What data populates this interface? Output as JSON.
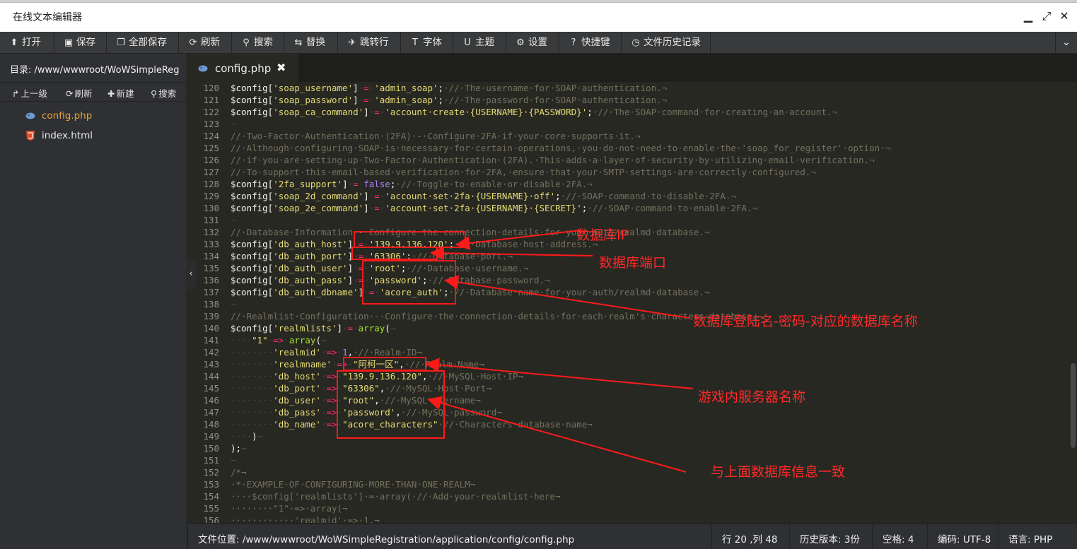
{
  "window": {
    "title": "在线文本编辑器",
    "minimize_glyph": "▁",
    "maximize_glyph": "⤢",
    "close_glyph": "✕"
  },
  "toolbar": [
    {
      "label": "打开",
      "icon": "upload-icon",
      "glyph": "⬆"
    },
    {
      "label": "保存",
      "icon": "save-icon",
      "glyph": "▣"
    },
    {
      "label": "全部保存",
      "icon": "save-all-icon",
      "glyph": "❐"
    },
    {
      "label": "刷新",
      "icon": "refresh-icon",
      "glyph": "⟳"
    },
    {
      "label": "搜索",
      "icon": "search-icon",
      "glyph": "⚲"
    },
    {
      "label": "替换",
      "icon": "replace-icon",
      "glyph": "⇆"
    },
    {
      "label": "跳转行",
      "icon": "goto-line-icon",
      "glyph": "✈"
    },
    {
      "label": "字体",
      "icon": "font-icon",
      "glyph": "T"
    },
    {
      "label": "主题",
      "icon": "theme-icon",
      "glyph": "U"
    },
    {
      "label": "设置",
      "icon": "gear-icon",
      "glyph": "⚙"
    },
    {
      "label": "快捷键",
      "icon": "help-icon",
      "glyph": "?"
    },
    {
      "label": "文件历史记录",
      "icon": "history-icon",
      "glyph": "◷"
    }
  ],
  "toolbar_dropdown_glyph": "⌄",
  "sidebar": {
    "dir_label": "目录:",
    "dir_path": "/www/wwwroot/WoWSimpleRegi",
    "tools": [
      {
        "label": "上一级",
        "icon": "up-level-icon",
        "glyph": "↱"
      },
      {
        "label": "刷新",
        "icon": "refresh-icon",
        "glyph": "⟳"
      },
      {
        "label": "新建",
        "icon": "plus-icon",
        "glyph": "✚"
      },
      {
        "label": "搜索",
        "icon": "search-icon",
        "glyph": "⚲"
      }
    ],
    "files": [
      {
        "name": "config.php",
        "type": "php",
        "color": "#e6a23c"
      },
      {
        "name": "index.html",
        "type": "html",
        "color": "#e8e8e8"
      }
    ],
    "collapse_glyph": "‹"
  },
  "tab": {
    "name": "config.php",
    "close_glyph": "✖"
  },
  "code_lines": [
    {
      "n": "120",
      "t": [
        [
          "$config[",
          "v"
        ],
        [
          "'soap_username'",
          "s"
        ],
        [
          "]",
          "v"
        ],
        [
          "·",
          "ws"
        ],
        [
          "=",
          "o"
        ],
        [
          "·",
          "ws"
        ],
        [
          "'admin_soap'",
          "s"
        ],
        [
          ";",
          "v"
        ],
        [
          "·//·The·username·for·SOAP·authentication.¬",
          "c"
        ]
      ]
    },
    {
      "n": "121",
      "t": [
        [
          "$config[",
          "v"
        ],
        [
          "'soap_password'",
          "s"
        ],
        [
          "]",
          "v"
        ],
        [
          "·",
          "ws"
        ],
        [
          "=",
          "o"
        ],
        [
          "·",
          "ws"
        ],
        [
          "'admin_soap'",
          "s"
        ],
        [
          ";",
          "v"
        ],
        [
          "·//·The·password·for·SOAP·authentication.¬",
          "c"
        ]
      ]
    },
    {
      "n": "122",
      "t": [
        [
          "$config[",
          "v"
        ],
        [
          "'soap_ca_command'",
          "s"
        ],
        [
          "]",
          "v"
        ],
        [
          "·",
          "ws"
        ],
        [
          "=",
          "o"
        ],
        [
          "·",
          "ws"
        ],
        [
          "'account·create·{USERNAME}·{PASSWORD}'",
          "s"
        ],
        [
          ";",
          "v"
        ],
        [
          "·//·The·SOAP·command·for·creating·an·account.¬",
          "c"
        ]
      ]
    },
    {
      "n": "123",
      "t": [
        [
          "¬",
          "ws"
        ]
      ]
    },
    {
      "n": "124",
      "t": [
        [
          "//·Two-Factor·Authentication·(2FA)·-·Configure·2FA·if·your·core·supports·it.¬",
          "c"
        ]
      ]
    },
    {
      "n": "125",
      "t": [
        [
          "//·Although·configuring·SOAP·is·necessary·for·certain·operations,·you·do·not·need·to·enable·the·'soap_for_register'·option·¬",
          "c"
        ]
      ]
    },
    {
      "n": "126",
      "t": [
        [
          "//·if·you·are·setting·up·Two-Factor·Authentication·(2FA).·This·adds·a·layer·of·security·by·utilizing·email·verification.¬",
          "c"
        ]
      ]
    },
    {
      "n": "127",
      "t": [
        [
          "//·To·support·this·email-based·verification·for·2FA,·ensure·that·your·SMTP·settings·are·correctly·configured.¬",
          "c"
        ]
      ]
    },
    {
      "n": "128",
      "t": [
        [
          "$config[",
          "v"
        ],
        [
          "'2fa_support'",
          "s"
        ],
        [
          "]",
          "v"
        ],
        [
          "·",
          "ws"
        ],
        [
          "=",
          "o"
        ],
        [
          "·",
          "ws"
        ],
        [
          "false",
          "k"
        ],
        [
          ";",
          "v"
        ],
        [
          "·//·Toggle·to·enable·or·disable·2FA.¬",
          "c"
        ]
      ]
    },
    {
      "n": "129",
      "t": [
        [
          "$config[",
          "v"
        ],
        [
          "'soap_2d_command'",
          "s"
        ],
        [
          "]",
          "v"
        ],
        [
          "·",
          "ws"
        ],
        [
          "=",
          "o"
        ],
        [
          "·",
          "ws"
        ],
        [
          "'account·set·2fa·{USERNAME}·off'",
          "s"
        ],
        [
          ";",
          "v"
        ],
        [
          "·//·SOAP·command·to·disable·2FA.¬",
          "c"
        ]
      ]
    },
    {
      "n": "130",
      "t": [
        [
          "$config[",
          "v"
        ],
        [
          "'soap_2e_command'",
          "s"
        ],
        [
          "]",
          "v"
        ],
        [
          "·",
          "ws"
        ],
        [
          "=",
          "o"
        ],
        [
          "·",
          "ws"
        ],
        [
          "'account·set·2fa·{USERNAME}·{SECRET}'",
          "s"
        ],
        [
          ";",
          "v"
        ],
        [
          "·//·SOAP·command·to·enable·2FA.¬",
          "c"
        ]
      ]
    },
    {
      "n": "131",
      "t": [
        [
          "¬",
          "ws"
        ]
      ]
    },
    {
      "n": "132",
      "t": [
        [
          "//·Database·Information·-·Configure·the·connection·details·for·your·auth/realmd·database.¬",
          "c"
        ]
      ]
    },
    {
      "n": "133",
      "t": [
        [
          "$config[",
          "v"
        ],
        [
          "'db_auth_host'",
          "s"
        ],
        [
          "]",
          "v"
        ],
        [
          "·",
          "ws"
        ],
        [
          "=",
          "o"
        ],
        [
          "·",
          "ws"
        ],
        [
          "'139.9.136.120'",
          "s"
        ],
        [
          ";",
          "v"
        ],
        [
          "·//·Database·host·address.¬",
          "c"
        ]
      ]
    },
    {
      "n": "134",
      "t": [
        [
          "$config[",
          "v"
        ],
        [
          "'db_auth_port'",
          "s"
        ],
        [
          "]",
          "v"
        ],
        [
          "·",
          "ws"
        ],
        [
          "=",
          "o"
        ],
        [
          "·",
          "ws"
        ],
        [
          "'63306'",
          "s"
        ],
        [
          ";",
          "v"
        ],
        [
          "·//·Database·port.¬",
          "c"
        ]
      ]
    },
    {
      "n": "135",
      "t": [
        [
          "$config[",
          "v"
        ],
        [
          "'db_auth_user'",
          "s"
        ],
        [
          "]",
          "v"
        ],
        [
          "·",
          "ws"
        ],
        [
          "=",
          "o"
        ],
        [
          "·",
          "ws"
        ],
        [
          "'root'",
          "s"
        ],
        [
          ";",
          "v"
        ],
        [
          "·//·Database·username.¬",
          "c"
        ]
      ]
    },
    {
      "n": "136",
      "t": [
        [
          "$config[",
          "v"
        ],
        [
          "'db_auth_pass'",
          "s"
        ],
        [
          "]",
          "v"
        ],
        [
          "·",
          "ws"
        ],
        [
          "=",
          "o"
        ],
        [
          "·",
          "ws"
        ],
        [
          "'password'",
          "s"
        ],
        [
          ";",
          "v"
        ],
        [
          "·//·Database·password.¬",
          "c"
        ]
      ]
    },
    {
      "n": "137",
      "t": [
        [
          "$config[",
          "v"
        ],
        [
          "'db_auth_dbname'",
          "s"
        ],
        [
          "]",
          "v"
        ],
        [
          "·",
          "ws"
        ],
        [
          "=",
          "o"
        ],
        [
          "·",
          "ws"
        ],
        [
          "'acore_auth'",
          "s"
        ],
        [
          ";",
          "v"
        ],
        [
          "·//·Database·name·for·your·auth/realmd·database.¬",
          "c"
        ]
      ]
    },
    {
      "n": "138",
      "t": [
        [
          "¬",
          "ws"
        ]
      ]
    },
    {
      "n": "139",
      "t": [
        [
          "//·Realmlist·Configuration·-·Configure·the·connection·details·for·each·realm's·characters·database.¬",
          "c"
        ]
      ]
    },
    {
      "n": "140",
      "t": [
        [
          "$config[",
          "v"
        ],
        [
          "'realmlists'",
          "s"
        ],
        [
          "]",
          "v"
        ],
        [
          "·",
          "ws"
        ],
        [
          "=",
          "o"
        ],
        [
          "·",
          "ws"
        ],
        [
          "array",
          "f"
        ],
        [
          "(",
          "v"
        ],
        [
          "¬",
          "ws"
        ]
      ]
    },
    {
      "n": "141",
      "t": [
        [
          "····",
          "ws"
        ],
        [
          "\"1\"",
          "s"
        ],
        [
          "·",
          "ws"
        ],
        [
          "=>",
          "o"
        ],
        [
          "·",
          "ws"
        ],
        [
          "array",
          "f"
        ],
        [
          "(",
          "v"
        ],
        [
          "¬",
          "ws"
        ]
      ]
    },
    {
      "n": "142",
      "t": [
        [
          "········",
          "ws"
        ],
        [
          "'realmid'",
          "s"
        ],
        [
          "·",
          "ws"
        ],
        [
          "=>",
          "o"
        ],
        [
          "·",
          "ws"
        ],
        [
          "1",
          "k"
        ],
        [
          ",",
          "v"
        ],
        [
          "·//·Realm·ID¬",
          "c"
        ]
      ]
    },
    {
      "n": "143",
      "t": [
        [
          "········",
          "ws"
        ],
        [
          "'realmname'",
          "s"
        ],
        [
          "·",
          "ws"
        ],
        [
          "=>",
          "o"
        ],
        [
          "·",
          "ws"
        ],
        [
          "\"阿柯一区\"",
          "s"
        ],
        [
          ",",
          "v"
        ],
        [
          "·//·Realm·Name¬",
          "c"
        ]
      ]
    },
    {
      "n": "144",
      "t": [
        [
          "········",
          "ws"
        ],
        [
          "'db_host'",
          "s"
        ],
        [
          "·",
          "ws"
        ],
        [
          "=>",
          "o"
        ],
        [
          "·",
          "ws"
        ],
        [
          "\"139.9.136.120\"",
          "s"
        ],
        [
          ",",
          "v"
        ],
        [
          "·//·MySQL·Host·IP¬",
          "c"
        ]
      ]
    },
    {
      "n": "145",
      "t": [
        [
          "········",
          "ws"
        ],
        [
          "'db_port'",
          "s"
        ],
        [
          "·",
          "ws"
        ],
        [
          "=>",
          "o"
        ],
        [
          "·",
          "ws"
        ],
        [
          "\"63306\"",
          "s"
        ],
        [
          ",",
          "v"
        ],
        [
          "·//·MySQL·Host·Port¬",
          "c"
        ]
      ]
    },
    {
      "n": "146",
      "t": [
        [
          "········",
          "ws"
        ],
        [
          "'db_user'",
          "s"
        ],
        [
          "·",
          "ws"
        ],
        [
          "=>",
          "o"
        ],
        [
          "·",
          "ws"
        ],
        [
          "\"root\"",
          "s"
        ],
        [
          ",",
          "v"
        ],
        [
          "·//·MySQL·username¬",
          "c"
        ]
      ]
    },
    {
      "n": "147",
      "t": [
        [
          "········",
          "ws"
        ],
        [
          "'db_pass'",
          "s"
        ],
        [
          "·",
          "ws"
        ],
        [
          "=>",
          "o"
        ],
        [
          "·",
          "ws"
        ],
        [
          "'password'",
          "s"
        ],
        [
          ",",
          "v"
        ],
        [
          "·//·MySQL·password¬",
          "c"
        ]
      ]
    },
    {
      "n": "148",
      "t": [
        [
          "········",
          "ws"
        ],
        [
          "'db_name'",
          "s"
        ],
        [
          "·",
          "ws"
        ],
        [
          "=>",
          "o"
        ],
        [
          "·",
          "ws"
        ],
        [
          "\"acore_characters\"",
          "s"
        ],
        [
          "·//·Characters·database·name¬",
          "c"
        ]
      ]
    },
    {
      "n": "149",
      "t": [
        [
          "····",
          "ws"
        ],
        [
          ")",
          "v"
        ],
        [
          "¬",
          "ws"
        ]
      ]
    },
    {
      "n": "150",
      "t": [
        [
          ");",
          "v"
        ],
        [
          "¬",
          "ws"
        ]
      ]
    },
    {
      "n": "151",
      "t": [
        [
          "¬",
          "ws"
        ]
      ]
    },
    {
      "n": "152",
      "t": [
        [
          "/*¬",
          "c"
        ]
      ]
    },
    {
      "n": "153",
      "t": [
        [
          "·*·EXAMPLE·OF·CONFIGURING·MORE·THAN·ONE·REALM¬",
          "c"
        ]
      ]
    },
    {
      "n": "154",
      "t": [
        [
          "····$config['realmlists']·=·array(·//·Add·your·realmlist·here¬",
          "c"
        ]
      ]
    },
    {
      "n": "155",
      "t": [
        [
          "········\"1\"·=>·array(¬",
          "c"
        ]
      ]
    },
    {
      "n": "156",
      "t": [
        [
          "············'realmid'·=>·1,¬",
          "c"
        ]
      ]
    }
  ],
  "annotations": [
    {
      "id": "db-ip",
      "text": "数据库IP"
    },
    {
      "id": "db-port",
      "text": "数据库端口"
    },
    {
      "id": "db-login",
      "text": "数据库登陆名-密码-对应的数据库名称"
    },
    {
      "id": "server-name",
      "text": "游戏内服务器名称"
    },
    {
      "id": "same-db",
      "text": "与上面数据库信息一致"
    }
  ],
  "annotation_color": "#ff1a1a",
  "statusbar": {
    "file_location": "文件位置: /www/wwwroot/WoWSimpleRegistration/application/config/config.php",
    "cursor": "行 20 ,列 48",
    "history": "历史版本: 3份",
    "indent": "空格: 4",
    "encoding": "编码: UTF-8",
    "language": "语言: PHP"
  }
}
